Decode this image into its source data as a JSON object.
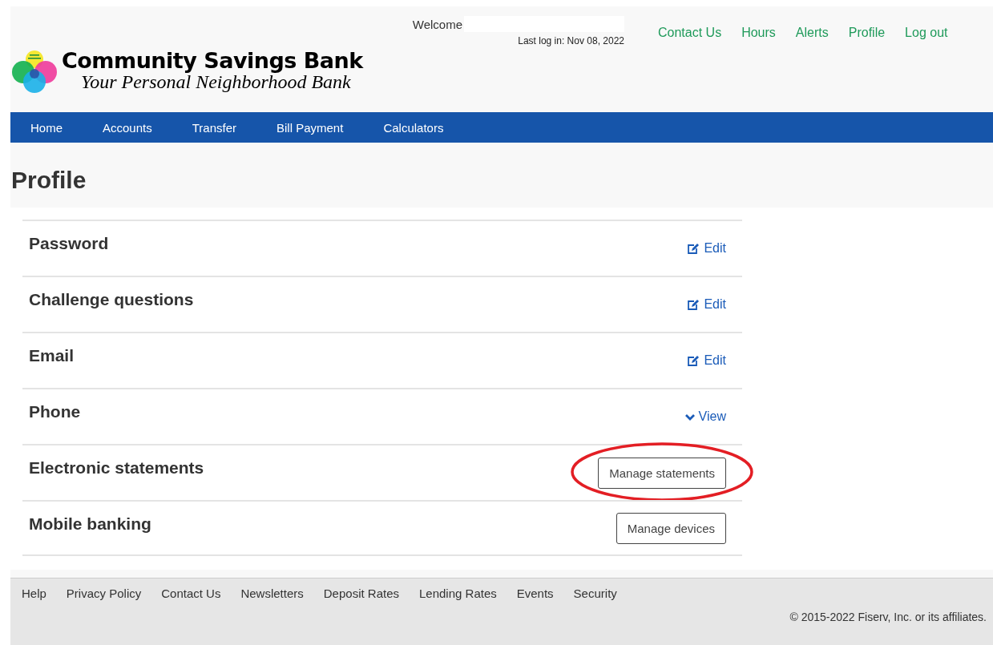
{
  "header": {
    "bank_name": "Community Savings Bank",
    "tagline": "Your Personal Neighborhood Bank",
    "welcome": "Welcome",
    "last_login": "Last log in: Nov 08, 2022",
    "links": [
      "Contact Us",
      "Hours",
      "Alerts",
      "Profile",
      "Log out"
    ]
  },
  "nav": {
    "items": [
      "Home",
      "Accounts",
      "Transfer",
      "Bill Payment",
      "Calculators"
    ]
  },
  "page_title": "Profile",
  "settings": [
    {
      "label": "Password",
      "kind": "edit",
      "action": "Edit",
      "highlighted": false
    },
    {
      "label": "Challenge questions",
      "kind": "edit",
      "action": "Edit",
      "highlighted": false
    },
    {
      "label": "Email",
      "kind": "edit",
      "action": "Edit",
      "highlighted": false
    },
    {
      "label": "Phone",
      "kind": "view",
      "action": "View",
      "highlighted": false
    },
    {
      "label": "Electronic statements",
      "kind": "button",
      "action": "Manage statements",
      "highlighted": true
    },
    {
      "label": "Mobile banking",
      "kind": "button",
      "action": "Manage devices",
      "highlighted": false
    }
  ],
  "footer": {
    "links": [
      "Help",
      "Privacy Policy",
      "Contact Us",
      "Newsletters",
      "Deposit Rates",
      "Lending Rates",
      "Events",
      "Security"
    ],
    "copyright": "© 2015-2022 Fiserv, Inc. or its affiliates."
  }
}
